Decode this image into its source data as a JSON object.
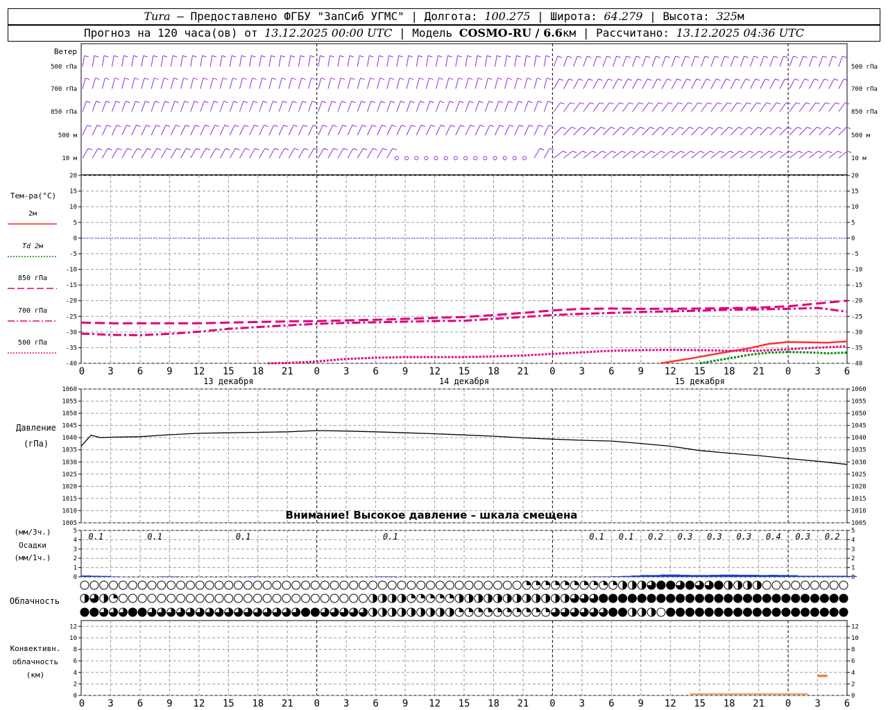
{
  "header": {
    "station": "Tura",
    "provided_by": "– Предоставлено ФГБУ \"ЗапСиб УГМС\" | Долгота:",
    "longitude": "100.275",
    "lat_label": "| Широта:",
    "latitude": "64.279",
    "alt_label": "| Высота:",
    "altitude": "325",
    "altitude_unit": "м",
    "forecast_label": "Прогноз на 120 часа(ов) от",
    "forecast_start": "13.12.2025 00:00 UTC",
    "model_label": "| Модель",
    "model": "COSMO-RU / 6.6",
    "model_unit": "км",
    "calc_label": "| Рассчитано:",
    "calculated": "13.12.2025 04:36 UTC"
  },
  "time_axis": {
    "hour_labels": [
      "0",
      "3",
      "6",
      "9",
      "12",
      "15",
      "18",
      "21",
      "0",
      "3",
      "6",
      "9",
      "12",
      "15",
      "18",
      "21",
      "0",
      "3",
      "6",
      "9",
      "12",
      "15",
      "18",
      "21",
      "0",
      "3",
      "6"
    ],
    "day_labels": [
      {
        "hour": 15,
        "label": "13 декабря"
      },
      {
        "hour": 39,
        "label": "14 декабря"
      },
      {
        "hour": 63,
        "label": "15 декабря"
      }
    ]
  },
  "wind_panel": {
    "title": "Ветер",
    "levels": [
      "500 гПа",
      "700 гПа",
      "850 гПа",
      "500 м",
      "10  м"
    ]
  },
  "temperature_panel": {
    "ylabel": "Тем-ра(°C)",
    "ticks": [
      20,
      15,
      10,
      5,
      0,
      -5,
      -10,
      -15,
      -20,
      -25,
      -30,
      -35,
      -40
    ],
    "legend": [
      {
        "label": "2м",
        "color": "#ff2020",
        "style": "solid"
      },
      {
        "label": "Td  2м",
        "color": "#008000",
        "style": "dotted"
      },
      {
        "label": "850 гПа",
        "color": "#e0007a",
        "style": "long-dash"
      },
      {
        "label": "700 гПа",
        "color": "#e0007a",
        "style": "dash-dot"
      },
      {
        "label": "500 гПа",
        "color": "#e0007a",
        "style": "dotted"
      }
    ]
  },
  "pressure_panel": {
    "ylabel": "Давление",
    "unit": "(гПа)",
    "ticks": [
      1060,
      1055,
      1050,
      1045,
      1040,
      1035,
      1030,
      1025,
      1020,
      1015,
      1010,
      1005
    ],
    "warning": "Внимание! Высокое давление – шкала смещена"
  },
  "precip_panel": {
    "label_top": "(мм/3ч.)",
    "label_mid": "Осадки",
    "label_bot": "(мм/1ч.)",
    "ticks": [
      5,
      4,
      3,
      2,
      1,
      0
    ],
    "amounts": [
      {
        "hour": 1.5,
        "value": "0.1"
      },
      {
        "hour": 7.5,
        "value": "0.1"
      },
      {
        "hour": 16.5,
        "value": "0.1"
      },
      {
        "hour": 31.5,
        "value": "0.1"
      },
      {
        "hour": 52.5,
        "value": "0.1"
      },
      {
        "hour": 55.5,
        "value": "0.1"
      },
      {
        "hour": 58.5,
        "value": "0.2"
      },
      {
        "hour": 61.5,
        "value": "0.3"
      },
      {
        "hour": 64.5,
        "value": "0.3"
      },
      {
        "hour": 67.5,
        "value": "0.3"
      },
      {
        "hour": 70.5,
        "value": "0.4"
      },
      {
        "hour": 73.5,
        "value": "0.3"
      },
      {
        "hour": 76.5,
        "value": "0.2"
      }
    ]
  },
  "cloud_panel": {
    "label": "Облачность"
  },
  "convective_panel": {
    "label1": "Конвективн.",
    "label2": "облачность",
    "label3": "(км)",
    "ticks": [
      12,
      10,
      8,
      6,
      4,
      2,
      0
    ]
  },
  "chart_data": [
    {
      "type": "line",
      "title": "Тем-ра(°C)",
      "x_unit": "hours from 13.12.2025 00 UTC",
      "ylim": [
        -40,
        20
      ],
      "series": [
        {
          "name": "2м",
          "x": [
            59,
            62,
            65,
            68,
            70,
            72,
            74,
            76,
            78
          ],
          "values": [
            -40,
            -38.5,
            -36.8,
            -35.2,
            -33.8,
            -33.2,
            -33.3,
            -33.4,
            -33.0
          ]
        },
        {
          "name": "Td  2м",
          "x": [
            63,
            66,
            68,
            70,
            72,
            74,
            76,
            78
          ],
          "values": [
            -40,
            -38.4,
            -37.3,
            -36.6,
            -36.4,
            -36.5,
            -36.8,
            -36.6
          ]
        },
        {
          "name": "850 гПа",
          "x": [
            0,
            3,
            6,
            9,
            12,
            15,
            18,
            21,
            24,
            27,
            30,
            33,
            36,
            39,
            42,
            45,
            48,
            51,
            54,
            57,
            60,
            63,
            66,
            69,
            72,
            75,
            78
          ],
          "values": [
            -27.0,
            -27.2,
            -27.2,
            -27.2,
            -27.2,
            -27.0,
            -26.8,
            -26.6,
            -26.5,
            -26.3,
            -26.1,
            -25.8,
            -25.5,
            -25.2,
            -24.6,
            -23.9,
            -23.1,
            -22.6,
            -22.5,
            -22.6,
            -22.6,
            -22.5,
            -22.4,
            -22.2,
            -21.8,
            -20.9,
            -20.0
          ]
        },
        {
          "name": "700 гПа",
          "x": [
            0,
            3,
            6,
            9,
            12,
            15,
            18,
            21,
            24,
            27,
            30,
            33,
            36,
            39,
            42,
            45,
            48,
            51,
            54,
            57,
            60,
            63,
            66,
            69,
            72,
            75,
            78
          ],
          "values": [
            -30.5,
            -30.9,
            -31.0,
            -30.6,
            -29.9,
            -29.0,
            -28.4,
            -27.9,
            -27.4,
            -27.1,
            -26.9,
            -26.7,
            -26.5,
            -26.4,
            -25.8,
            -25.2,
            -24.6,
            -24.2,
            -23.9,
            -23.6,
            -23.4,
            -23.2,
            -22.9,
            -22.8,
            -22.6,
            -22.3,
            -23.5
          ]
        },
        {
          "name": "500 гПа",
          "x": [
            19,
            21,
            24,
            27,
            30,
            33,
            36,
            39,
            42,
            45,
            48,
            51,
            54,
            57,
            60,
            63,
            66,
            69,
            72,
            75,
            78
          ],
          "values": [
            -40,
            -39.9,
            -39.4,
            -38.6,
            -38.2,
            -38.0,
            -38.0,
            -38.0,
            -37.8,
            -37.5,
            -37.0,
            -36.5,
            -36.0,
            -35.8,
            -35.7,
            -35.8,
            -36.0,
            -36.0,
            -35.5,
            -35.0,
            -34.6
          ]
        }
      ]
    },
    {
      "type": "line",
      "title": "Давление",
      "ylabel": "(гПа)",
      "ylim": [
        1005,
        1060
      ],
      "series": [
        {
          "name": "Давление",
          "x": [
            0,
            1,
            2,
            3,
            6,
            9,
            12,
            15,
            18,
            21,
            24,
            27,
            30,
            33,
            36,
            39,
            42,
            45,
            48,
            51,
            54,
            57,
            60,
            63,
            66,
            69,
            72,
            75,
            78
          ],
          "values": [
            1036.5,
            1041.0,
            1040.0,
            1040.2,
            1040.4,
            1041.2,
            1041.8,
            1042.0,
            1042.2,
            1042.4,
            1042.9,
            1042.7,
            1042.4,
            1042.0,
            1041.6,
            1041.1,
            1040.6,
            1039.9,
            1039.4,
            1038.9,
            1038.6,
            1037.6,
            1036.5,
            1034.7,
            1033.6,
            1032.6,
            1031.4,
            1030.3,
            1029.0
          ]
        }
      ]
    },
    {
      "type": "bar",
      "title": "Осадки",
      "ylabel": "(мм/1ч.)",
      "ylim": [
        0,
        5
      ],
      "x": [
        0,
        1,
        2,
        3,
        8,
        9,
        17,
        30,
        31,
        52,
        53,
        54,
        55,
        56,
        57,
        58,
        59,
        60,
        61,
        62,
        63,
        64,
        65,
        66,
        67,
        68,
        69,
        70,
        71,
        72,
        73,
        74,
        75,
        76,
        77,
        78
      ],
      "values": [
        0.15,
        0.12,
        0.1,
        0.05,
        0.05,
        0.05,
        0.05,
        0.05,
        0.05,
        0.05,
        0.05,
        0.07,
        0.1,
        0.15,
        0.2,
        0.2,
        0.25,
        0.25,
        0.22,
        0.2,
        0.2,
        0.22,
        0.24,
        0.24,
        0.22,
        0.22,
        0.2,
        0.22,
        0.2,
        0.18,
        0.12,
        0.12,
        0.12,
        0.12,
        0.12,
        0.1
      ]
    },
    {
      "type": "table",
      "title": "Облачность",
      "rows": [
        {
          "name": "high",
          "values": [
            0,
            0,
            0,
            0,
            0,
            0,
            0,
            0,
            0,
            0,
            0,
            0,
            0,
            0,
            0,
            0,
            0,
            0,
            0,
            0,
            0,
            0,
            0,
            0,
            0,
            0,
            0,
            0,
            0,
            0,
            0,
            0,
            0,
            0,
            0,
            0,
            0,
            0,
            0,
            0,
            0,
            0,
            0,
            0,
            0,
            0,
            1,
            1,
            1,
            1,
            1,
            1,
            1,
            1,
            1,
            1,
            2,
            2,
            2,
            3,
            4,
            4,
            3,
            4,
            3,
            3,
            4,
            2,
            2,
            2,
            2,
            0,
            0,
            0,
            0,
            0,
            0,
            0,
            0,
            0
          ]
        },
        {
          "name": "middle",
          "values": [
            2,
            3,
            2,
            1,
            0,
            0,
            0,
            0,
            0,
            0,
            0,
            0,
            0,
            0,
            0,
            0,
            0,
            0,
            0,
            0,
            0,
            0,
            0,
            0,
            0,
            0,
            0,
            0,
            0,
            0,
            2,
            2,
            2,
            2,
            1,
            1,
            1,
            1,
            1,
            2,
            2,
            2,
            2,
            2,
            2,
            2,
            2,
            2,
            2,
            2,
            2,
            3,
            3,
            3,
            4,
            4,
            4,
            4,
            4,
            4,
            4,
            4,
            4,
            4,
            4,
            4,
            4,
            4,
            4,
            4,
            4,
            4,
            4,
            4,
            4,
            4,
            4,
            4,
            4,
            4
          ]
        },
        {
          "name": "low",
          "values": [
            4,
            4,
            3,
            3,
            3,
            4,
            4,
            3,
            3,
            3,
            3,
            3,
            3,
            3,
            3,
            3,
            3,
            3,
            3,
            3,
            3,
            3,
            3,
            4,
            4,
            3,
            3,
            3,
            3,
            3,
            2,
            2,
            2,
            2,
            2,
            2,
            2,
            2,
            2,
            1,
            1,
            1,
            1,
            1,
            1,
            1,
            1,
            1,
            1,
            3,
            3,
            3,
            3,
            3,
            3,
            4,
            4,
            2,
            2,
            2,
            0,
            4,
            4,
            4,
            4,
            4,
            4,
            4,
            4,
            4,
            4,
            4,
            4,
            4,
            4,
            4,
            4,
            4,
            4,
            4
          ]
        }
      ]
    },
    {
      "type": "bar",
      "title": "Конвективн. облачность",
      "ylabel": "(км)",
      "ylim": [
        0,
        13
      ],
      "ranges": [
        {
          "x_start": 75,
          "x_end": 76,
          "bottom": 3.2,
          "top": 3.6
        },
        {
          "x_start": 62,
          "x_end": 74,
          "bottom": 0.15,
          "top": 0.35
        }
      ]
    }
  ]
}
